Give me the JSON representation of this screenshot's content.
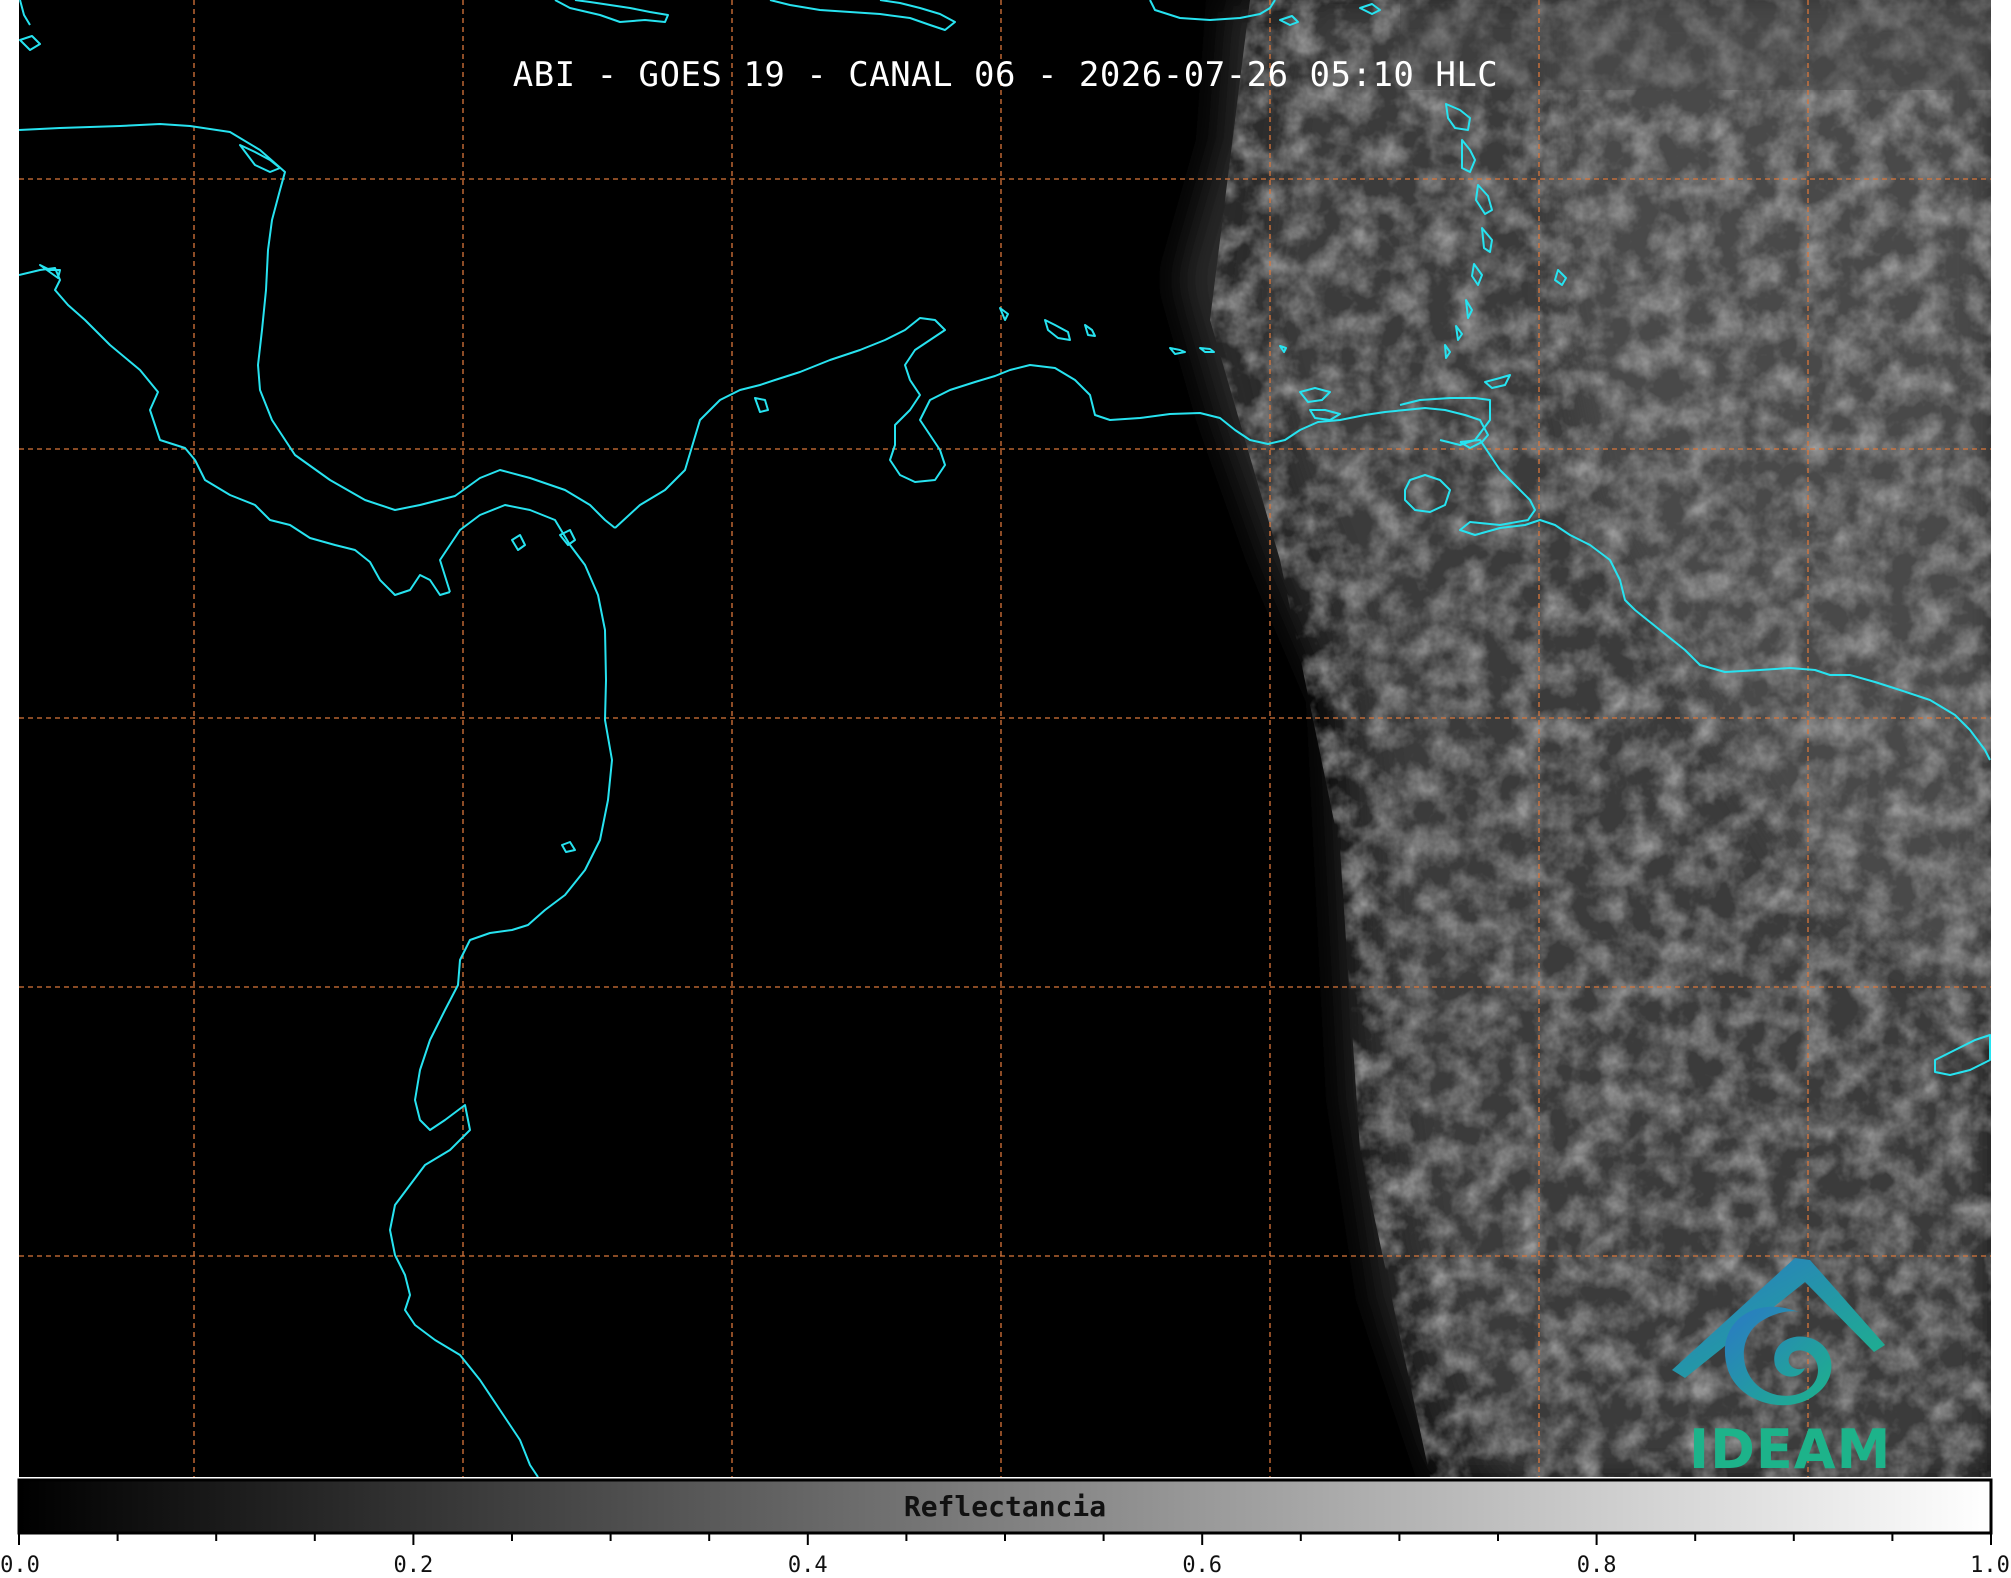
{
  "title": "ABI - GOES 19 - CANAL 06 - 2026-07-26 05:10 HLC",
  "colors": {
    "background": "#000000",
    "coastline": "#27e3f0",
    "gridlines": "#d9763a",
    "logo_blue": "#2b78c6",
    "logo_teal": "#1db38a"
  },
  "map": {
    "gridlines": "dashed",
    "coastlines": true,
    "imagery": "grayscale reflectance, cloud cover over the eastern portion"
  },
  "colorbar": {
    "label": "Reflectancia",
    "min": 0.0,
    "max": 1.0,
    "colormap": "grayscale black-to-white",
    "ticks": [
      {
        "value": 0.0,
        "label": "0.0"
      },
      {
        "value": 0.2,
        "label": "0.2"
      },
      {
        "value": 0.4,
        "label": "0.4"
      },
      {
        "value": 0.6,
        "label": "0.6"
      },
      {
        "value": 0.8,
        "label": "0.8"
      },
      {
        "value": 1.0,
        "label": "1.0"
      }
    ],
    "minor_tick_step": 0.05
  },
  "logo": {
    "text": "IDEAM",
    "icon": "ideam-swirl-roof-logo"
  }
}
